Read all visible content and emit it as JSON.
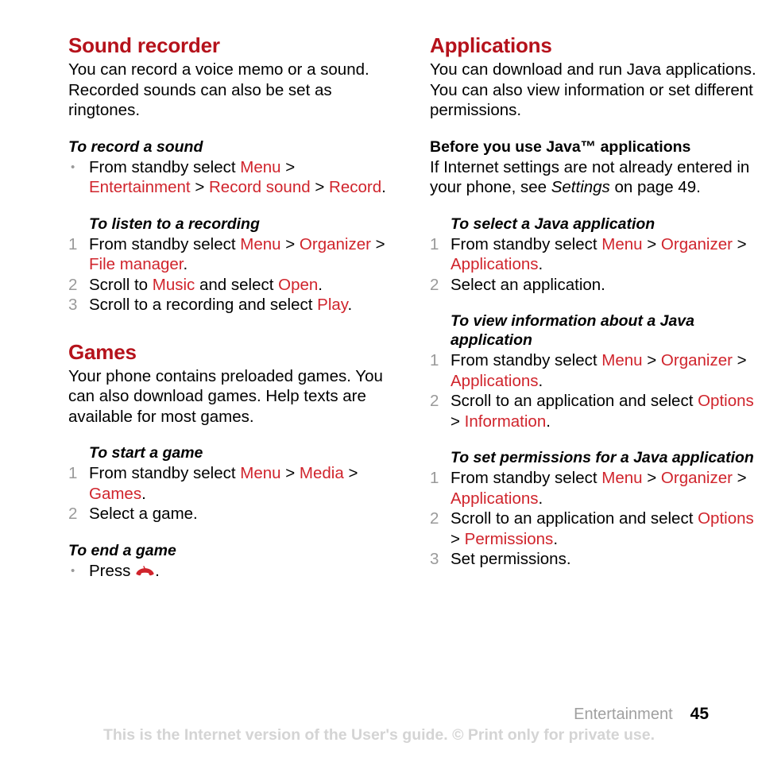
{
  "document": {
    "left_column": {
      "sections": [
        {
          "heading": "Sound recorder",
          "intro": "You can record a voice memo or a sound. Recorded sounds can also be set as ringtones.",
          "tasks": [
            {
              "subhead": "To record a sound",
              "marker_type": "bullet",
              "steps": [
                {
                  "marker": "•",
                  "parts": [
                    {
                      "text": "From standby select ",
                      "style": "plain"
                    },
                    {
                      "text": "Menu",
                      "style": "uiterm"
                    },
                    {
                      "text": " > ",
                      "style": "plain"
                    },
                    {
                      "text": "Entertainment",
                      "style": "uiterm"
                    },
                    {
                      "text": " > ",
                      "style": "plain"
                    },
                    {
                      "text": "Record sound",
                      "style": "uiterm"
                    },
                    {
                      "text": " > ",
                      "style": "plain"
                    },
                    {
                      "text": "Record",
                      "style": "uiterm"
                    },
                    {
                      "text": ".",
                      "style": "plain"
                    }
                  ]
                }
              ]
            },
            {
              "subhead": "To listen to a recording",
              "marker_type": "number",
              "steps": [
                {
                  "marker": "1",
                  "parts": [
                    {
                      "text": "From standby select ",
                      "style": "plain"
                    },
                    {
                      "text": "Menu",
                      "style": "uiterm"
                    },
                    {
                      "text": " > ",
                      "style": "plain"
                    },
                    {
                      "text": "Organizer",
                      "style": "uiterm"
                    },
                    {
                      "text": " > ",
                      "style": "plain"
                    },
                    {
                      "text": "File manager",
                      "style": "uiterm"
                    },
                    {
                      "text": ".",
                      "style": "plain"
                    }
                  ]
                },
                {
                  "marker": "2",
                  "parts": [
                    {
                      "text": "Scroll to ",
                      "style": "plain"
                    },
                    {
                      "text": "Music",
                      "style": "uiterm"
                    },
                    {
                      "text": " and select ",
                      "style": "plain"
                    },
                    {
                      "text": "Open",
                      "style": "uiterm"
                    },
                    {
                      "text": ".",
                      "style": "plain"
                    }
                  ]
                },
                {
                  "marker": "3",
                  "parts": [
                    {
                      "text": "Scroll to a recording and select ",
                      "style": "plain"
                    },
                    {
                      "text": "Play",
                      "style": "uiterm"
                    },
                    {
                      "text": ".",
                      "style": "plain"
                    }
                  ]
                }
              ]
            }
          ]
        },
        {
          "heading": "Games",
          "intro": "Your phone contains preloaded games. You can also download games. Help texts are available for most games.",
          "tasks": [
            {
              "subhead": "To start a game",
              "marker_type": "number",
              "steps": [
                {
                  "marker": "1",
                  "parts": [
                    {
                      "text": "From standby select ",
                      "style": "plain"
                    },
                    {
                      "text": "Menu",
                      "style": "uiterm"
                    },
                    {
                      "text": " > ",
                      "style": "plain"
                    },
                    {
                      "text": "Media",
                      "style": "uiterm"
                    },
                    {
                      "text": " > ",
                      "style": "plain"
                    },
                    {
                      "text": "Games",
                      "style": "uiterm"
                    },
                    {
                      "text": ".",
                      "style": "plain"
                    }
                  ]
                },
                {
                  "marker": "2",
                  "parts": [
                    {
                      "text": "Select a game.",
                      "style": "plain"
                    }
                  ]
                }
              ]
            },
            {
              "subhead": "To end a game",
              "marker_type": "bullet",
              "steps": [
                {
                  "marker": "•",
                  "parts": [
                    {
                      "text": "Press ",
                      "style": "plain"
                    },
                    {
                      "text": "",
                      "style": "endcall-icon"
                    },
                    {
                      "text": ".",
                      "style": "plain"
                    }
                  ]
                }
              ]
            }
          ]
        }
      ]
    },
    "right_column": {
      "sections": [
        {
          "heading": "Applications",
          "intro": "You can download and run Java applications. You can also view information or set different permissions.",
          "tasks": [
            {
              "subhead": "Before you use Java™ applications",
              "subhead_style": "upright",
              "marker_type": "none",
              "paragraph_parts": [
                {
                  "text": "If Internet settings are not already entered in your phone, see ",
                  "style": "plain"
                },
                {
                  "text": "Settings",
                  "style": "italic"
                },
                {
                  "text": " on page 49.",
                  "style": "plain"
                }
              ]
            },
            {
              "subhead": "To select a Java application",
              "marker_type": "number",
              "steps": [
                {
                  "marker": "1",
                  "parts": [
                    {
                      "text": "From standby select ",
                      "style": "plain"
                    },
                    {
                      "text": "Menu",
                      "style": "uiterm"
                    },
                    {
                      "text": " > ",
                      "style": "plain"
                    },
                    {
                      "text": "Organizer",
                      "style": "uiterm"
                    },
                    {
                      "text": " > ",
                      "style": "plain"
                    },
                    {
                      "text": "Applications",
                      "style": "uiterm"
                    },
                    {
                      "text": ".",
                      "style": "plain"
                    }
                  ]
                },
                {
                  "marker": "2",
                  "parts": [
                    {
                      "text": "Select an application.",
                      "style": "plain"
                    }
                  ]
                }
              ]
            },
            {
              "subhead": "To view information about a Java application",
              "marker_type": "number",
              "steps": [
                {
                  "marker": "1",
                  "parts": [
                    {
                      "text": "From standby select ",
                      "style": "plain"
                    },
                    {
                      "text": "Menu",
                      "style": "uiterm"
                    },
                    {
                      "text": " > ",
                      "style": "plain"
                    },
                    {
                      "text": "Organizer",
                      "style": "uiterm"
                    },
                    {
                      "text": " > ",
                      "style": "plain"
                    },
                    {
                      "text": "Applications",
                      "style": "uiterm"
                    },
                    {
                      "text": ".",
                      "style": "plain"
                    }
                  ]
                },
                {
                  "marker": "2",
                  "parts": [
                    {
                      "text": "Scroll to an application and select ",
                      "style": "plain"
                    },
                    {
                      "text": "Options",
                      "style": "uiterm"
                    },
                    {
                      "text": " > ",
                      "style": "plain"
                    },
                    {
                      "text": "Information",
                      "style": "uiterm"
                    },
                    {
                      "text": ".",
                      "style": "plain"
                    }
                  ]
                }
              ]
            },
            {
              "subhead": "To set permissions for a Java application",
              "marker_type": "number",
              "steps": [
                {
                  "marker": "1",
                  "parts": [
                    {
                      "text": "From standby select ",
                      "style": "plain"
                    },
                    {
                      "text": "Menu",
                      "style": "uiterm"
                    },
                    {
                      "text": " > ",
                      "style": "plain"
                    },
                    {
                      "text": "Organizer",
                      "style": "uiterm"
                    },
                    {
                      "text": " > ",
                      "style": "plain"
                    },
                    {
                      "text": "Applications",
                      "style": "uiterm"
                    },
                    {
                      "text": ".",
                      "style": "plain"
                    }
                  ]
                },
                {
                  "marker": "2",
                  "parts": [
                    {
                      "text": "Scroll to an application and select ",
                      "style": "plain"
                    },
                    {
                      "text": "Options",
                      "style": "uiterm"
                    },
                    {
                      "text": " > ",
                      "style": "plain"
                    },
                    {
                      "text": "Permissions",
                      "style": "uiterm"
                    },
                    {
                      "text": ".",
                      "style": "plain"
                    }
                  ]
                },
                {
                  "marker": "3",
                  "parts": [
                    {
                      "text": "Set permissions.",
                      "style": "plain"
                    }
                  ]
                }
              ]
            }
          ]
        }
      ]
    },
    "footer": {
      "running_head": "Entertainment",
      "page_number": "45",
      "watermark": "This is the Internet version of the User's guide. © Print only for private use."
    },
    "colors": {
      "heading_red": "#b5121b",
      "uiterm_red": "#d0242c",
      "marker_gray": "#9a9a9a",
      "running_head_gray": "#a0a0a0",
      "watermark_gray": "#d4d4d4"
    }
  }
}
